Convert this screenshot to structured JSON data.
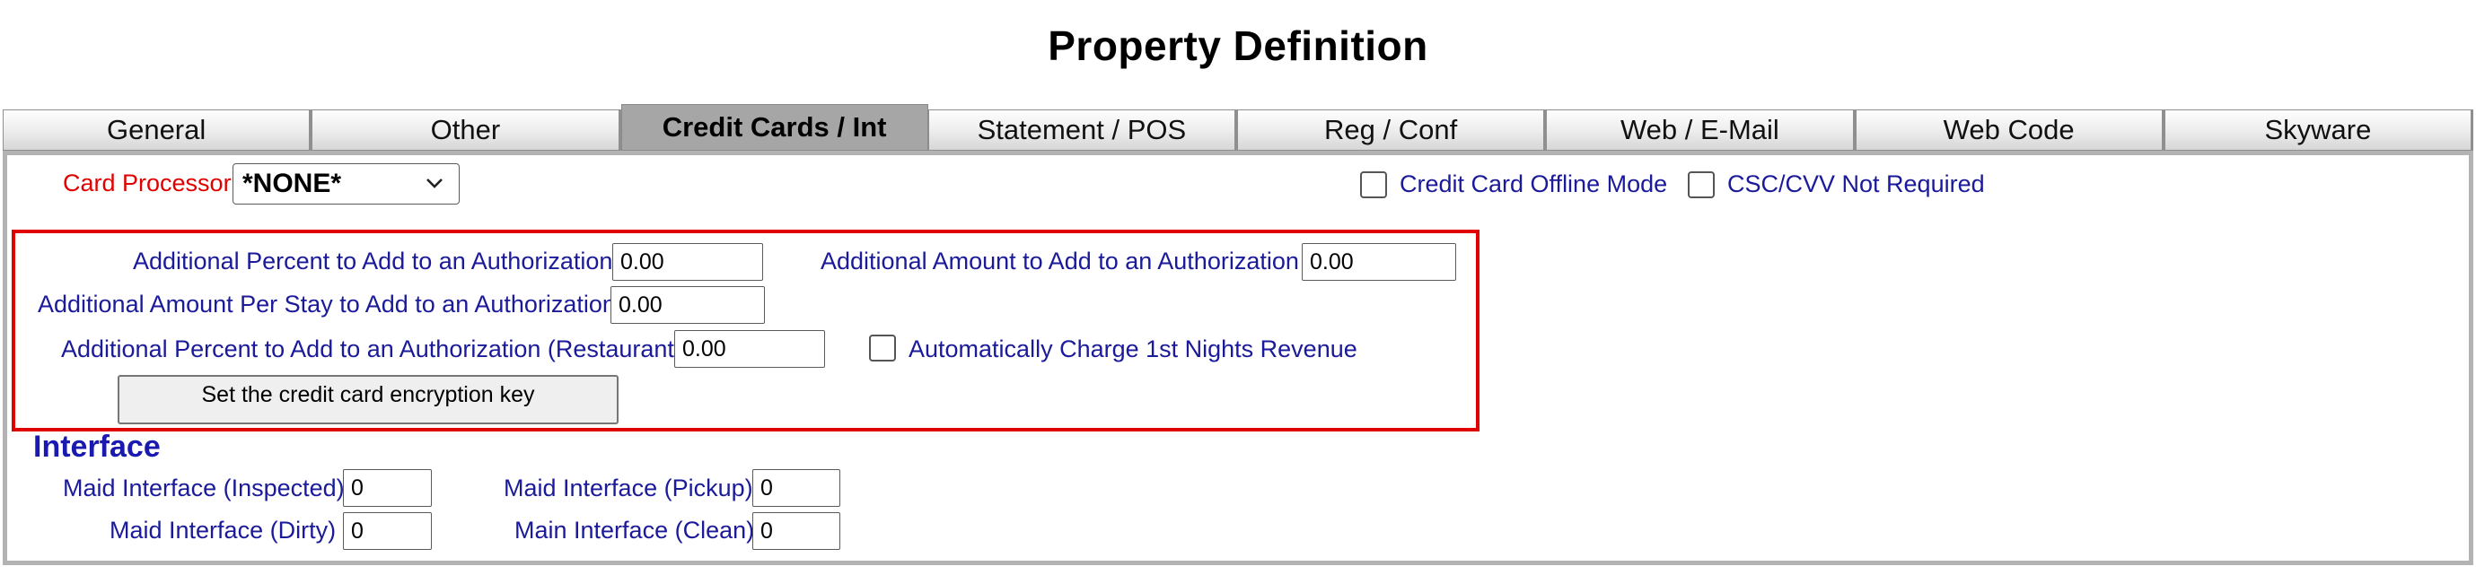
{
  "page": {
    "title": "Property Definition"
  },
  "tabs": [
    {
      "label": "General"
    },
    {
      "label": "Other"
    },
    {
      "label": "Credit Cards / Int",
      "active": true
    },
    {
      "label": "Statement / POS"
    },
    {
      "label": "Reg / Conf"
    },
    {
      "label": "Web / E-Mail"
    },
    {
      "label": "Web Code"
    },
    {
      "label": "Skyware"
    }
  ],
  "card": {
    "processor_label": "Card Processor",
    "processor_value": "*NONE*",
    "offline_mode_label": "Credit Card Offline Mode",
    "cvv_not_required_label": "CSC/CVV Not Required"
  },
  "authorization": {
    "percent_label": "Additional Percent to Add to an Authorization",
    "percent_value": "0.00",
    "amount_label": "Additional Amount to Add to an Authorization",
    "amount_value": "0.00",
    "per_stay_label": "Additional Amount Per Stay to Add to an Authorization",
    "per_stay_value": "0.00",
    "restaurant_label": "Additional Percent to Add to an Authorization (Restaurant)",
    "restaurant_value": "0.00",
    "auto_charge_label": "Automatically Charge 1st Nights Revenue",
    "encryption_button": "Set the credit card encryption key"
  },
  "interface": {
    "title": "Interface",
    "maid_inspected_label": "Maid Interface (Inspected)",
    "maid_inspected_value": "0",
    "maid_pickup_label": "Maid Interface (Pickup)",
    "maid_pickup_value": "0",
    "maid_dirty_label": "Maid Interface (Dirty)",
    "maid_dirty_value": "0",
    "main_clean_label": "Main Interface (Clean)",
    "main_clean_value": "0"
  },
  "colors": {
    "label_blue": "#1a1a9a",
    "label_red": "#e00000",
    "highlight_border": "#e00000",
    "active_tab": "#a6a6a6"
  }
}
